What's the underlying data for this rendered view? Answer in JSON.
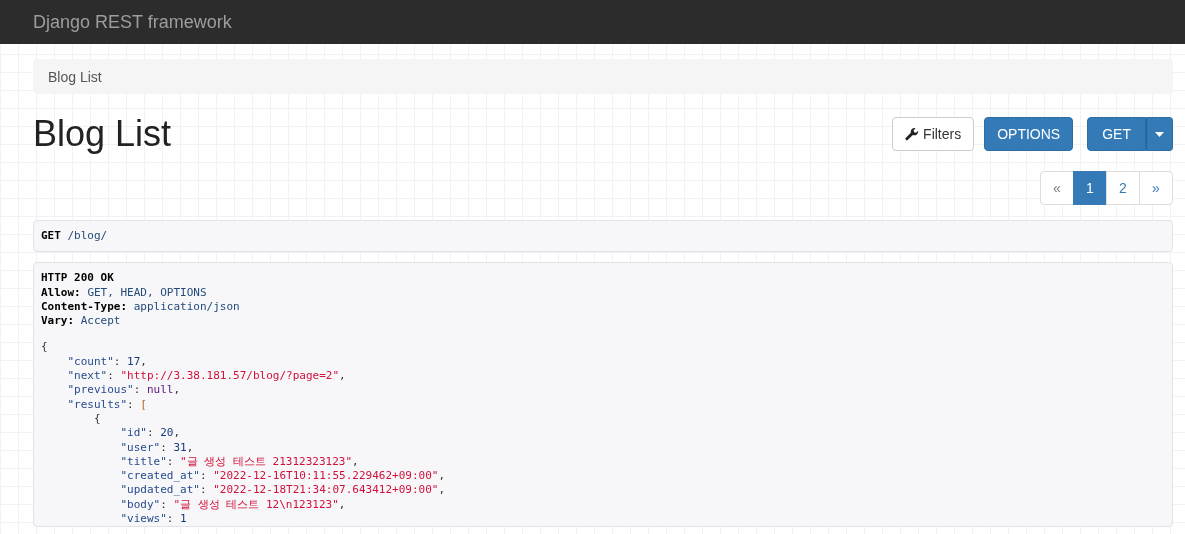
{
  "navbar": {
    "brand": "Django REST framework"
  },
  "breadcrumb": [
    {
      "label": "Blog List"
    }
  ],
  "page_title": "Blog List",
  "buttons": [
    {
      "kind": "filters",
      "label": "Filters"
    },
    {
      "kind": "primary",
      "label": "OPTIONS"
    },
    {
      "kind": "split",
      "label": "GET"
    }
  ],
  "pagination": [
    {
      "label": "«",
      "selected": false
    },
    {
      "label": "1",
      "selected": true
    },
    {
      "label": "2",
      "selected": false
    },
    {
      "label": "»",
      "selected": false
    }
  ],
  "request": {
    "method": "GET",
    "path": "/blog/"
  },
  "response": {
    "status": "HTTP 200 OK",
    "headers": [
      {
        "name": "Allow:",
        "value": "GET, HEAD, OPTIONS"
      },
      {
        "name": "Content-Type:",
        "value": "application/json"
      },
      {
        "name": "Vary:",
        "value": "Accept"
      }
    ],
    "body": [
      {
        "tokens": [
          {
            "kind": "punct",
            "text": "{"
          }
        ],
        "children": [
          {
            "tokens": [
              {
                "kind": "key",
                "text": "\"count\""
              },
              {
                "kind": "punct",
                "text": ": "
              },
              {
                "kind": "number",
                "text": "17"
              },
              {
                "kind": "punct",
                "text": ","
              }
            ]
          },
          {
            "tokens": [
              {
                "kind": "key",
                "text": "\"next\""
              },
              {
                "kind": "punct",
                "text": ": "
              },
              {
                "kind": "string",
                "text": "\"http://3.38.181.57/blog/?page=2\""
              },
              {
                "kind": "punct",
                "text": ","
              }
            ]
          },
          {
            "tokens": [
              {
                "kind": "key",
                "text": "\"previous\""
              },
              {
                "kind": "punct",
                "text": ": "
              },
              {
                "kind": "null",
                "text": "null"
              },
              {
                "kind": "punct",
                "text": ","
              }
            ]
          },
          {
            "tokens": [
              {
                "kind": "key",
                "text": "\"results\""
              },
              {
                "kind": "punct",
                "text": ": "
              },
              {
                "kind": "bracket",
                "text": "["
              }
            ],
            "children": [
              {
                "tokens": [
                  {
                    "kind": "punct",
                    "text": "{"
                  }
                ],
                "children": [
                  {
                    "tokens": [
                      {
                        "kind": "key",
                        "text": "\"id\""
                      },
                      {
                        "kind": "punct",
                        "text": ": "
                      },
                      {
                        "kind": "number",
                        "text": "20"
                      },
                      {
                        "kind": "punct",
                        "text": ","
                      }
                    ]
                  },
                  {
                    "tokens": [
                      {
                        "kind": "key",
                        "text": "\"user\""
                      },
                      {
                        "kind": "punct",
                        "text": ": "
                      },
                      {
                        "kind": "number",
                        "text": "31"
                      },
                      {
                        "kind": "punct",
                        "text": ","
                      }
                    ]
                  },
                  {
                    "tokens": [
                      {
                        "kind": "key",
                        "text": "\"title\""
                      },
                      {
                        "kind": "punct",
                        "text": ": "
                      },
                      {
                        "kind": "string",
                        "text": "\"글 생성 테스트 21312323123\""
                      },
                      {
                        "kind": "punct",
                        "text": ","
                      }
                    ]
                  },
                  {
                    "tokens": [
                      {
                        "kind": "key",
                        "text": "\"created_at\""
                      },
                      {
                        "kind": "punct",
                        "text": ": "
                      },
                      {
                        "kind": "string",
                        "text": "\"2022-12-16T10:11:55.229462+09:00\""
                      },
                      {
                        "kind": "punct",
                        "text": ","
                      }
                    ]
                  },
                  {
                    "tokens": [
                      {
                        "kind": "key",
                        "text": "\"updated_at\""
                      },
                      {
                        "kind": "punct",
                        "text": ": "
                      },
                      {
                        "kind": "string",
                        "text": "\"2022-12-18T21:34:07.643412+09:00\""
                      },
                      {
                        "kind": "punct",
                        "text": ","
                      }
                    ]
                  },
                  {
                    "tokens": [
                      {
                        "kind": "key",
                        "text": "\"body\""
                      },
                      {
                        "kind": "punct",
                        "text": ": "
                      },
                      {
                        "kind": "string",
                        "text": "\"글 생성 테스트 12\\n123123\""
                      },
                      {
                        "kind": "punct",
                        "text": ","
                      }
                    ]
                  },
                  {
                    "tokens": [
                      {
                        "kind": "key",
                        "text": "\"views\""
                      },
                      {
                        "kind": "punct",
                        "text": ": "
                      },
                      {
                        "kind": "number",
                        "text": "1"
                      }
                    ]
                  }
                ]
              }
            ]
          }
        ]
      }
    ]
  }
}
